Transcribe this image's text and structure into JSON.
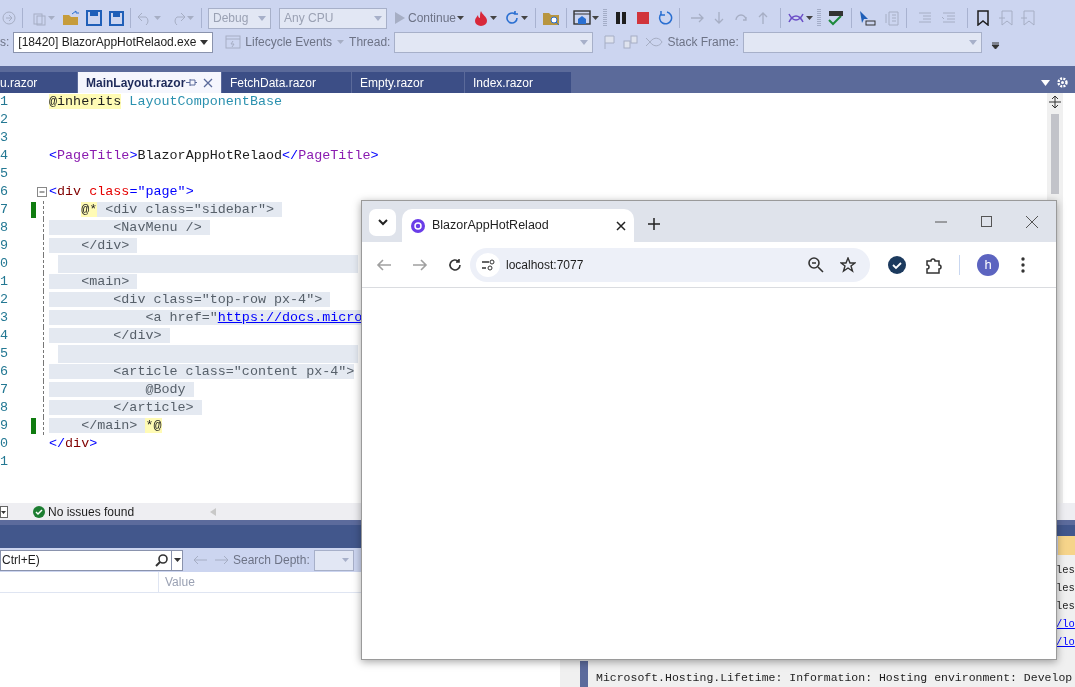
{
  "toolbar": {
    "configuration": {
      "value": "Debug",
      "disabled": true
    },
    "platform": {
      "value": "Any CPU",
      "disabled": true
    },
    "continue_label": "Continue",
    "process_label": "s:",
    "process": "[18420] BlazorAppHotRelaod.exe",
    "lifecycle_label": "Lifecycle Events",
    "thread_label": "Thread:",
    "stack_frame_label": "Stack Frame:"
  },
  "editor_tabs": [
    {
      "label": "u.razor",
      "selected": false
    },
    {
      "label": "MainLayout.razor",
      "selected": true
    },
    {
      "label": "FetchData.razor",
      "selected": false
    },
    {
      "label": "Empty.razor",
      "selected": false
    },
    {
      "label": "Index.razor",
      "selected": false
    }
  ],
  "code_lines": [
    {
      "number": "1",
      "changed": false,
      "fold": false,
      "in_comment": false,
      "indented": false,
      "tokens": [
        {
          "kind": "directive",
          "text": "@inherits"
        },
        {
          "kind": "type",
          "text": " LayoutComponentBase"
        }
      ]
    },
    {
      "number": "2",
      "changed": false,
      "fold": false,
      "in_comment": false
    },
    {
      "number": "3",
      "changed": false,
      "fold": false,
      "in_comment": false
    },
    {
      "number": "4",
      "changed": false,
      "fold": false,
      "in_comment": false,
      "indented": false,
      "tokens": [
        {
          "kind": "bracket",
          "text": "<"
        },
        {
          "kind": "component",
          "text": "PageTitle"
        },
        {
          "kind": "bracket",
          "text": ">"
        },
        {
          "kind": "plain",
          "text": "BlazorAppHotRelaod"
        },
        {
          "kind": "bracket",
          "text": "</"
        },
        {
          "kind": "component",
          "text": "PageTitle"
        },
        {
          "kind": "bracket",
          "text": ">"
        }
      ]
    },
    {
      "number": "5",
      "changed": false,
      "fold": false,
      "in_comment": false
    },
    {
      "number": "6",
      "changed": false,
      "fold": true,
      "in_comment": false,
      "indented": false,
      "tokens": [
        {
          "kind": "bracket",
          "text": "<"
        },
        {
          "kind": "element",
          "text": "div"
        },
        {
          "kind": "attr",
          "text": " class"
        },
        {
          "kind": "bracket",
          "text": "="
        },
        {
          "kind": "string",
          "text": "\"page\""
        },
        {
          "kind": "bracket",
          "text": ">"
        }
      ]
    },
    {
      "number": "7",
      "changed": true,
      "fold": false,
      "in_comment": true,
      "indented": true,
      "tokens": [
        {
          "kind": "directive",
          "text": "@*"
        },
        {
          "kind": "comment",
          "text": " <div class=\"sidebar\"> "
        }
      ]
    },
    {
      "number": "8",
      "changed": false,
      "fold": false,
      "in_comment": true,
      "indented": false,
      "tokens": [
        {
          "kind": "comment",
          "text": "        <NavMenu /> "
        }
      ]
    },
    {
      "number": "9",
      "changed": false,
      "fold": false,
      "in_comment": true,
      "indented": false,
      "tokens": [
        {
          "kind": "comment",
          "text": "    </div> "
        }
      ]
    },
    {
      "number": "0",
      "changed": false,
      "fold": false,
      "in_comment": true
    },
    {
      "number": "1",
      "changed": false,
      "fold": false,
      "in_comment": true,
      "indented": false,
      "tokens": [
        {
          "kind": "comment",
          "text": "    <main> "
        }
      ]
    },
    {
      "number": "2",
      "changed": false,
      "fold": false,
      "in_comment": true,
      "indented": false,
      "tokens": [
        {
          "kind": "comment",
          "text": "        <div class=\"top-row px-4\"> "
        }
      ]
    },
    {
      "number": "3",
      "changed": false,
      "fold": false,
      "in_comment": true,
      "indented": false,
      "tokens": [
        {
          "kind": "comment",
          "text": "            <a href=\""
        },
        {
          "kind": "link",
          "text": "https://docs.micro"
        }
      ]
    },
    {
      "number": "4",
      "changed": false,
      "fold": false,
      "in_comment": true,
      "indented": false,
      "tokens": [
        {
          "kind": "comment",
          "text": "        </div> "
        }
      ]
    },
    {
      "number": "5",
      "changed": false,
      "fold": false,
      "in_comment": true
    },
    {
      "number": "6",
      "changed": false,
      "fold": false,
      "in_comment": true,
      "indented": false,
      "tokens": [
        {
          "kind": "comment",
          "text": "        <article class=\"content px-4\">"
        }
      ]
    },
    {
      "number": "7",
      "changed": false,
      "fold": false,
      "in_comment": true,
      "indented": false,
      "tokens": [
        {
          "kind": "comment",
          "text": "            @Body "
        }
      ]
    },
    {
      "number": "8",
      "changed": false,
      "fold": false,
      "in_comment": true,
      "indented": false,
      "tokens": [
        {
          "kind": "comment",
          "text": "        </article> "
        }
      ]
    },
    {
      "number": "9",
      "changed": true,
      "fold": false,
      "in_comment": true,
      "indented": false,
      "tokens": [
        {
          "kind": "comment",
          "text": "    </main> "
        },
        {
          "kind": "directive",
          "text": "*@"
        }
      ]
    },
    {
      "number": "0",
      "changed": false,
      "fold": false,
      "in_comment": false,
      "indented": false,
      "tokens": [
        {
          "kind": "bracket",
          "text": "</"
        },
        {
          "kind": "element",
          "text": "div"
        },
        {
          "kind": "bracket",
          "text": ">"
        }
      ]
    },
    {
      "number": "1",
      "changed": false,
      "fold": false,
      "in_comment": false
    }
  ],
  "status": "No issues found",
  "watch": {
    "placeholder": "Ctrl+E)",
    "search_depth_label": "Search Depth:",
    "columns": [
      "Value"
    ]
  },
  "output": {
    "fragments": [
      {
        "text": "les",
        "link": false
      },
      {
        "text": "les",
        "link": false
      },
      {
        "text": "les",
        "link": false
      },
      {
        "text": "/lo",
        "link": true
      },
      {
        "text": "/lo",
        "link": true
      }
    ],
    "lines": [
      "Microsoft.Hosting.Lifetime: Information: Hosting environment: Develop"
    ]
  },
  "browser": {
    "tab_title": "BlazorAppHotRelaod",
    "address": "localhost:7077",
    "avatar": "h"
  }
}
